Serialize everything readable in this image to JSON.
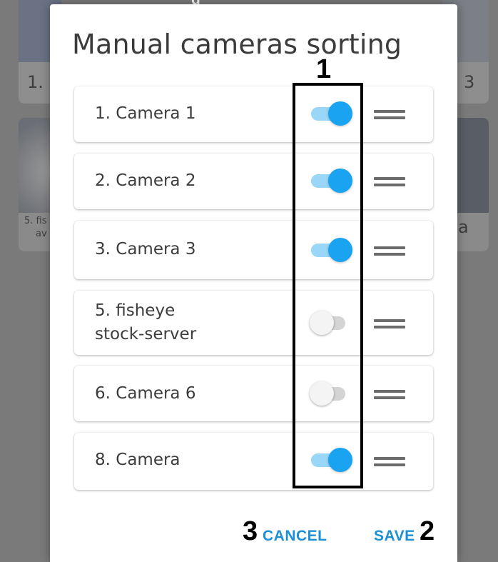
{
  "background": {
    "tile_labels": [
      "1.",
      "3",
      "5. fis",
      "av",
      "a"
    ],
    "top_caption_fragment": "g"
  },
  "dialog": {
    "title": "Manual cameras sorting",
    "cameras": [
      {
        "label": "1. Camera 1",
        "enabled": true
      },
      {
        "label": "2. Camera 2",
        "enabled": true
      },
      {
        "label": "3. Camera 3",
        "enabled": true
      },
      {
        "label": "5. fisheye\nstock-server",
        "enabled": false
      },
      {
        "label": "6. Camera 6",
        "enabled": false
      },
      {
        "label": "8. Camera",
        "enabled": true
      }
    ],
    "cancel_label": "CANCEL",
    "save_label": "SAVE"
  },
  "annotations": {
    "toggle_column": "1",
    "save": "2",
    "cancel": "3"
  },
  "colors": {
    "accent": "#1aa3f0",
    "toggle_on_track": "#99d6f7",
    "toggle_off_track": "#d4d4d4",
    "action_text": "#1c8fd6"
  }
}
